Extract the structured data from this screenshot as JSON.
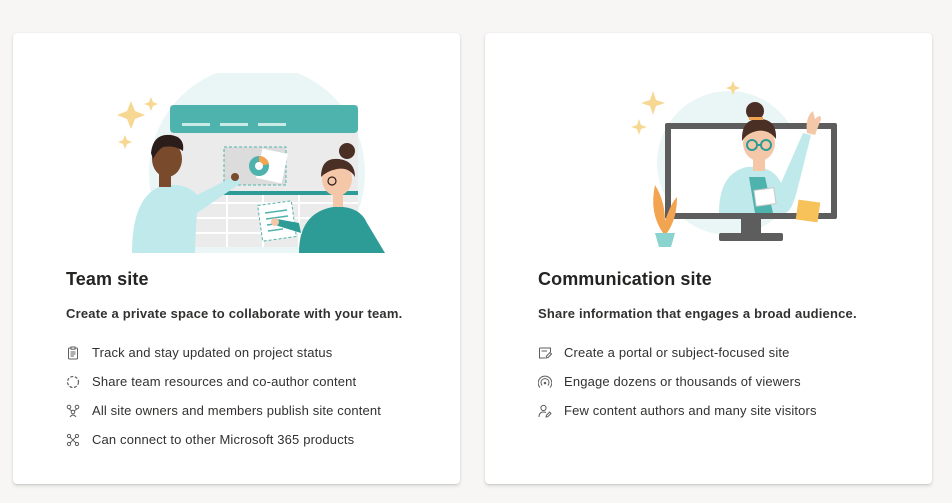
{
  "cards": [
    {
      "title": "Team site",
      "subtitle": "Create a private space to collaborate with your team.",
      "features": [
        {
          "icon": "clipboard-icon",
          "text": "Track and stay updated on project status"
        },
        {
          "icon": "dashed-circle-icon",
          "text": "Share team resources and co-author content"
        },
        {
          "icon": "people-network-icon",
          "text": "All site owners and members publish site content"
        },
        {
          "icon": "connector-icon",
          "text": "Can connect to other Microsoft 365 products"
        }
      ]
    },
    {
      "title": "Communication site",
      "subtitle": "Share information that engages a broad audience.",
      "features": [
        {
          "icon": "page-edit-icon",
          "text": "Create a portal or subject-focused site"
        },
        {
          "icon": "broadcast-icon",
          "text": "Engage dozens or thousands of viewers"
        },
        {
          "icon": "person-edit-icon",
          "text": "Few content authors and many site visitors"
        }
      ]
    }
  ],
  "colors": {
    "teal": "#4fb3ad",
    "teal_dark": "#2e9c96",
    "teal_light": "#c8ebe8",
    "sparkle": "#f7d892",
    "skin_dark": "#7a4a2c",
    "skin_light": "#f4c7a8",
    "hair_dark": "#2b1d1a",
    "hair_brown": "#4a2f25",
    "monitor": "#5d5d5d",
    "pie_orange": "#f3a451"
  }
}
